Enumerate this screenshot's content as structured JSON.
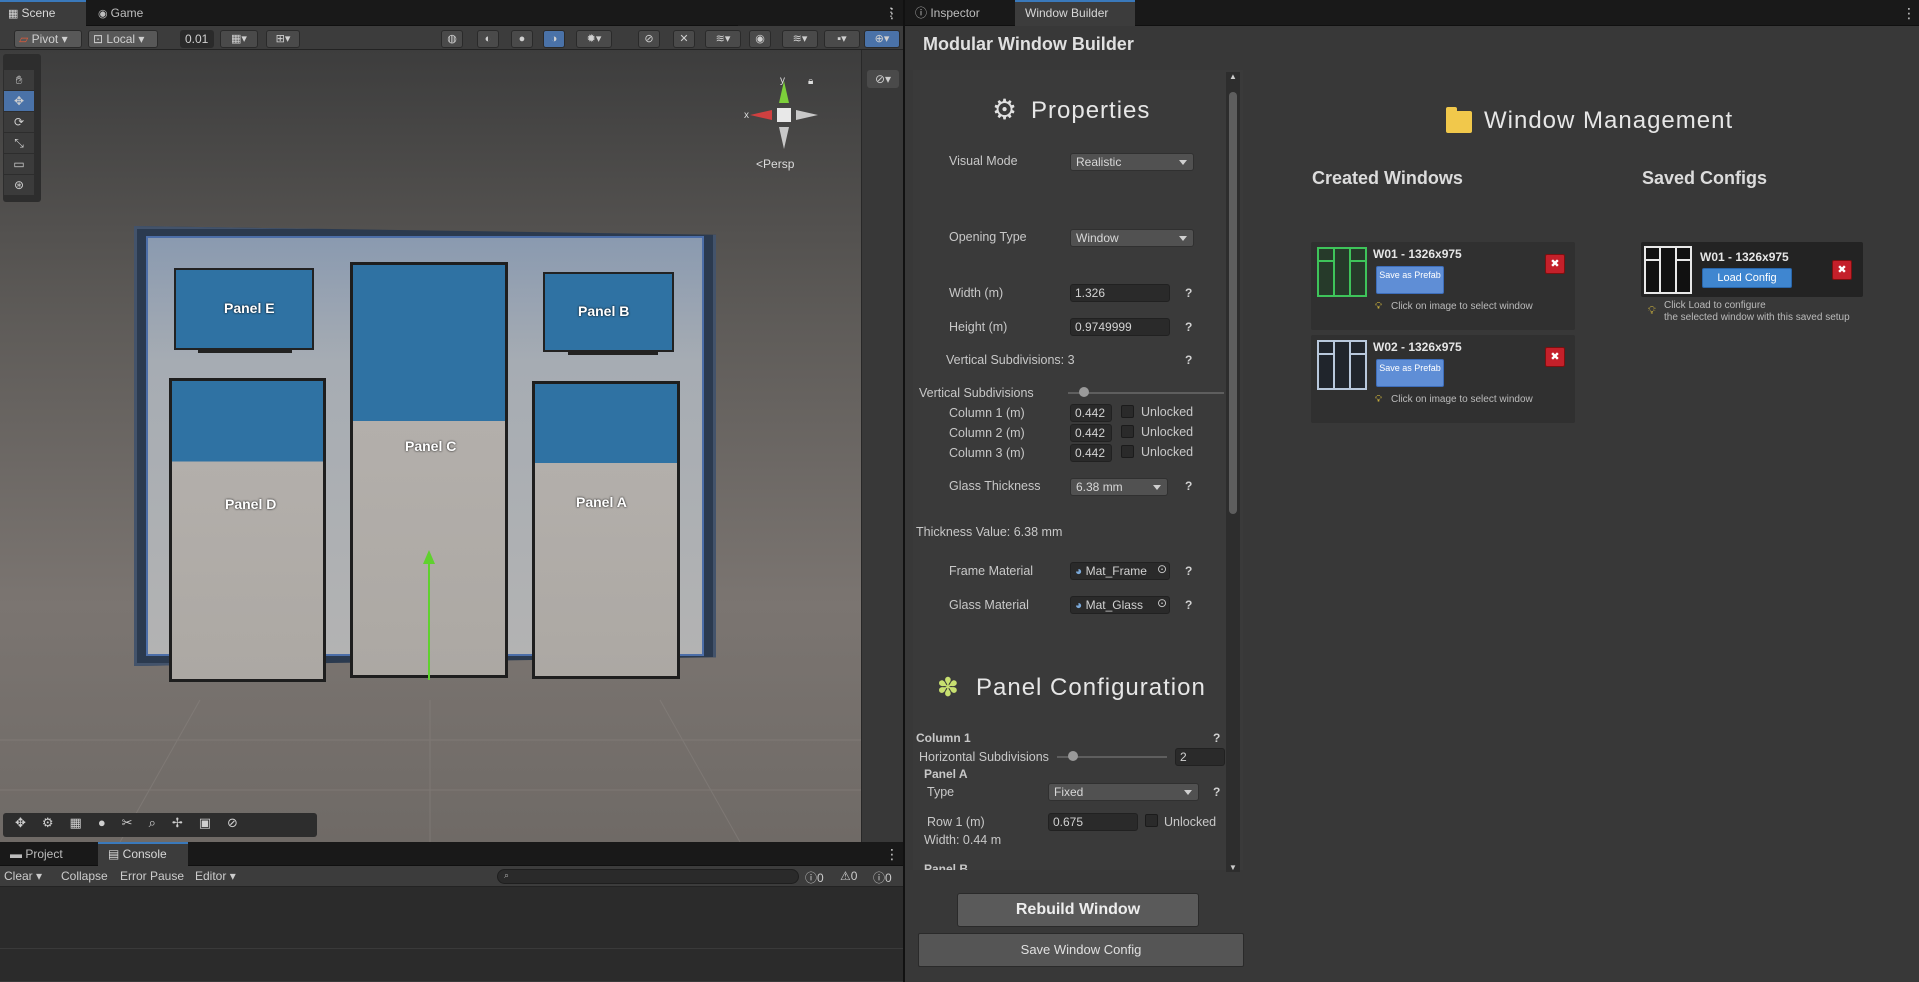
{
  "tabs": {
    "scene": "Scene",
    "game": "Game",
    "inspector": "Inspector",
    "window_builder": "Window Builder",
    "project": "Project",
    "console": "Console"
  },
  "scene_toolbar": {
    "pivot": "Pivot",
    "local": "Local",
    "snap_value": "0.01"
  },
  "gizmo": {
    "y": "y",
    "x": "x",
    "persp": "Persp"
  },
  "viewport": {
    "panel_e": "Panel E",
    "panel_b": "Panel B",
    "panel_c": "Panel C",
    "panel_d": "Panel D",
    "panel_a": "Panel A"
  },
  "console": {
    "clear": "Clear",
    "collapse": "Collapse",
    "error_pause": "Error Pause",
    "editor": "Editor",
    "count_log": "0",
    "count_warn": "0",
    "count_err": "0"
  },
  "builder": {
    "title": "Modular Window Builder",
    "properties_header": "Properties",
    "visual_mode_label": "Visual Mode",
    "visual_mode_value": "Realistic",
    "opening_type_label": "Opening Type",
    "opening_type_value": "Window",
    "width_label": "Width (m)",
    "width_value": "1.326",
    "height_label": "Height (m)",
    "height_value": "0.9749999",
    "vsub_info": "Vertical Subdivisions: 3",
    "vsub_slider_label": "Vertical Subdivisions",
    "columns": [
      {
        "label": "Column 1 (m)",
        "value": "0.442",
        "lock": "Unlocked"
      },
      {
        "label": "Column 2 (m)",
        "value": "0.442",
        "lock": "Unlocked"
      },
      {
        "label": "Column 3 (m)",
        "value": "0.442",
        "lock": "Unlocked"
      }
    ],
    "glass_thickness_label": "Glass Thickness",
    "glass_thickness_value": "6.38 mm",
    "thickness_value": "Thickness Value: 6.38 mm",
    "frame_material_label": "Frame Material",
    "frame_material_value": "Mat_Frame",
    "glass_material_label": "Glass Material",
    "glass_material_value": "Mat_Glass",
    "panel_config_header": "Panel Configuration",
    "column1": "Column 1",
    "hsub_label": "Horizontal Subdivisions",
    "hsub_value": "2",
    "panel_a": "Panel A",
    "type_label": "Type",
    "type_value": "Fixed",
    "row1_label": "Row 1 (m)",
    "row1_value": "0.675",
    "row1_lock": "Unlocked",
    "width_info": "Width: 0.44 m",
    "panel_b": "Panel B",
    "rebuild": "Rebuild Window",
    "save_config": "Save Window Config",
    "help": "?"
  },
  "management": {
    "header": "Window Management",
    "created_header": "Created Windows",
    "saved_header": "Saved Configs",
    "windows": [
      {
        "name": "W01 - 1326x975",
        "button": "Save as Prefab",
        "hint": "Click on image to select window"
      },
      {
        "name": "W02 - 1326x975",
        "button": "Save as Prefab",
        "hint": "Click on image to select window"
      }
    ],
    "saved": {
      "name": "W01 - 1326x975",
      "button": "Load Config",
      "hint1": "Click Load to configure",
      "hint2": "the selected window with this saved setup"
    }
  },
  "colors": {
    "accent": "#3a79bb",
    "delete": "#c4202a",
    "prefab": "#5f8ed6",
    "selected_thumb": "#3ec45a",
    "glass": "#2f72a3"
  }
}
